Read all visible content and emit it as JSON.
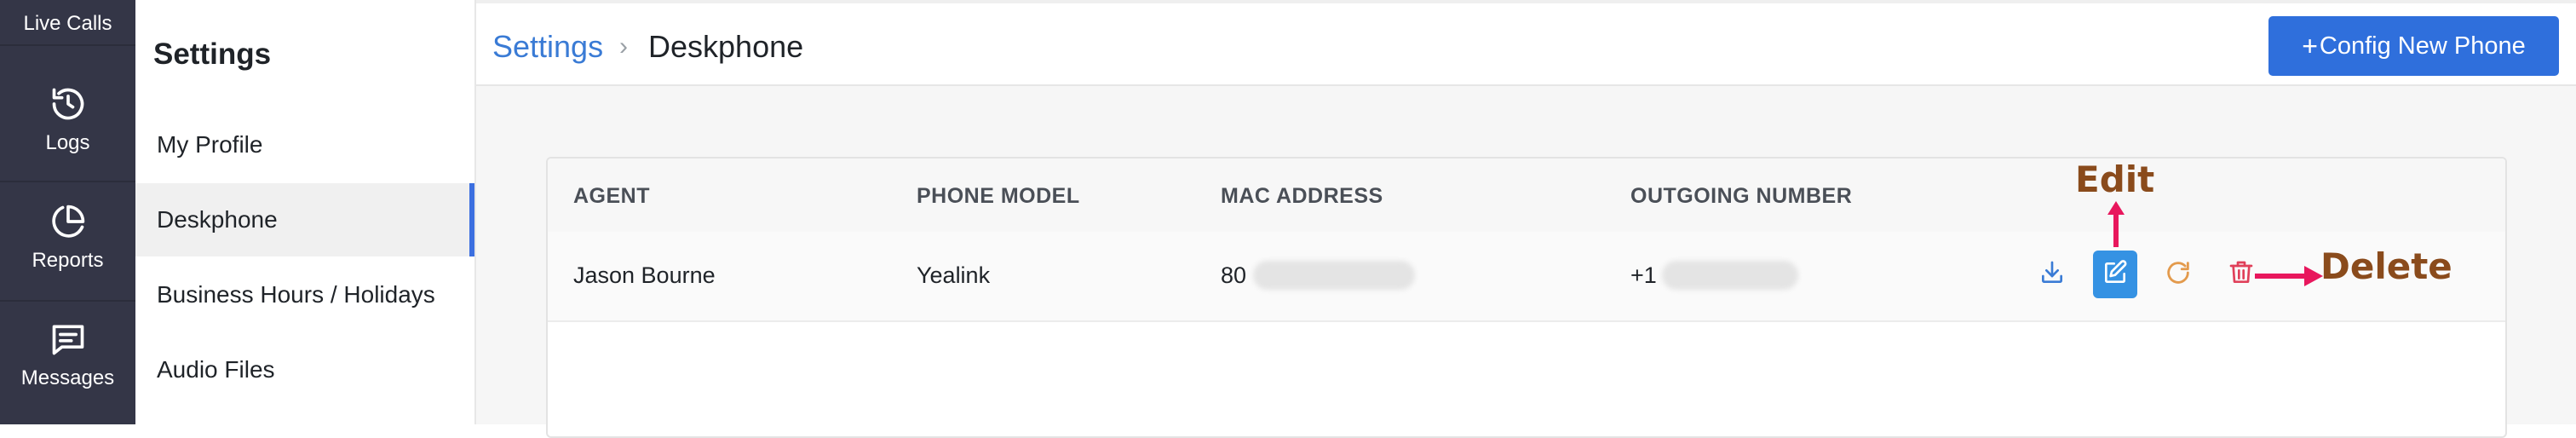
{
  "rail": {
    "top_label": "Live Calls",
    "items": [
      {
        "icon": "history-icon",
        "label": "Logs"
      },
      {
        "icon": "pie-chart-icon",
        "label": "Reports"
      },
      {
        "icon": "message-icon",
        "label": "Messages"
      }
    ]
  },
  "settings": {
    "title": "Settings",
    "menu": [
      {
        "label": "My Profile",
        "active": false
      },
      {
        "label": "Deskphone",
        "active": true
      },
      {
        "label": "Business Hours / Holidays",
        "active": false
      },
      {
        "label": "Audio Files",
        "active": false
      }
    ]
  },
  "header": {
    "breadcrumb_link": "Settings",
    "breadcrumb_sep": "›",
    "breadcrumb_current": "Deskphone",
    "config_button_plus": "+",
    "config_button_label": "Config New Phone"
  },
  "table": {
    "columns": [
      "AGENT",
      "PHONE MODEL",
      "MAC ADDRESS",
      "OUTGOING NUMBER"
    ],
    "rows": [
      {
        "agent": "Jason Bourne",
        "phone_model": "Yealink",
        "mac_prefix": "80",
        "outgoing_prefix": "+1"
      }
    ],
    "actions": [
      {
        "icon": "download-icon",
        "color": "#3a7bd5"
      },
      {
        "icon": "edit-icon",
        "color": "#3592e3"
      },
      {
        "icon": "refresh-icon",
        "color": "#e39a4c"
      },
      {
        "icon": "trash-icon",
        "color": "#e0405a"
      }
    ]
  },
  "annotations": {
    "edit_label": "Edit",
    "delete_label": "Delete",
    "arrow_color": "#e8175d",
    "text_color": "#8a4b1c"
  },
  "colors": {
    "rail_bg": "#343647",
    "accent": "#2f6fdc",
    "link": "#3a7bd5"
  }
}
